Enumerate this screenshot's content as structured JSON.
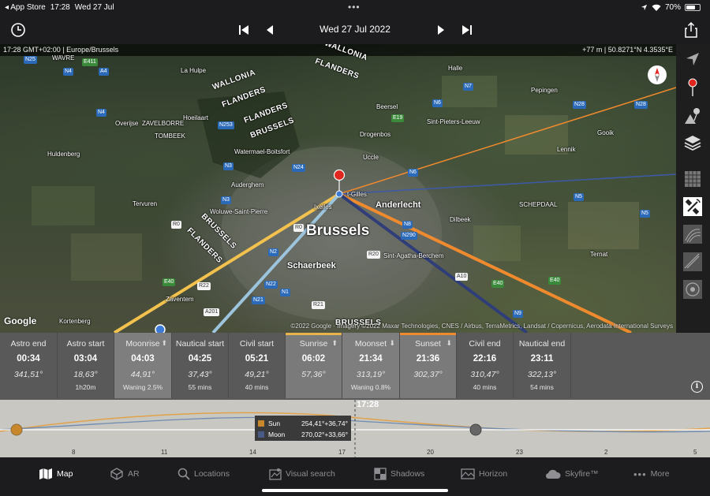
{
  "status": {
    "back_app": "◂ App Store",
    "time": "17:28",
    "date": "Wed 27 Jul",
    "battery": "70%",
    "battery_level": 0.7
  },
  "toolbar": {
    "date": "Wed 27 Jul 2022"
  },
  "map": {
    "time_zone_info": "17:28 GMT+02:00 | Europe/Brussels",
    "elevation_coords": "+77 m | 50.8271°N 4.3535°E",
    "google_label": "Google",
    "copyright": "©2022 Google · Imagery ©2022 Maxar Technologies, CNES / Airbus, TerraMetrics, Landsat / Copernicus, Aerodata International Surveys",
    "labels": {
      "brussels": "Brussels",
      "schaerbeek": "Schaerbeek",
      "anderlecht": "Anderlecht",
      "wallonia1": "WALLONIA",
      "wallonia2": "WALLONIA",
      "flanders1": "FLANDERS",
      "flanders2": "FLANDERS",
      "flanders3": "FLANDERS",
      "flanders4": "FLANDERS",
      "brussels_r1": "BRUSSELS",
      "brussels_r2": "BRUSSELS",
      "brussels_r3": "BRUSSELS",
      "overijse": "Overijse",
      "zavelborre": "ZAVELBORRE",
      "hoeilaart": "Hoeilaart",
      "tombeek": "TOMBEEK",
      "huldenberg": "Huldenberg",
      "watermael": "Watermael-Boitsfort",
      "uccle": "Uccle",
      "drogenbos": "Drogenbos",
      "beersel": "Beersel",
      "sint_pieters": "Sint-Pieters-Leeuw",
      "halle": "Halle",
      "pepingen": "Pepingen",
      "lennik": "Lennik",
      "gooik": "Gooik",
      "auderghem": "Auderghem",
      "tervuren": "Tervuren",
      "woluwe": "Woluwe-Saint-Pierre",
      "ixelles": "Ixelles",
      "saint_gilles": "t-Gilles",
      "dilbeek": "Dilbeek",
      "schepdaal": "SCHEPDAAL",
      "ternat": "Ternat",
      "sint_agatha": "Sint-Agatha-Berchem",
      "zaventem": "Zaventem",
      "kortenberg": "Kortenberg",
      "wavre": "WAVRE",
      "la_hulpe": "La Hulpe"
    },
    "road_badges": [
      "N25",
      "E411",
      "A4",
      "N4",
      "N4",
      "N253",
      "N3",
      "E40",
      "N2",
      "R22",
      "N22",
      "N21",
      "R21",
      "N1",
      "A201",
      "R20",
      "N24",
      "N3",
      "R0",
      "R0",
      "N5",
      "N6",
      "N8",
      "N290",
      "A10",
      "E40",
      "N9",
      "E19",
      "N6",
      "N28",
      "N28",
      "N7",
      "N5",
      "E40"
    ]
  },
  "sidebar": {
    "icons": [
      "location-arrow-icon",
      "map-pin-icon",
      "elevation-pin-icon",
      "layers-icon",
      "grid-icon",
      "satellite-icon",
      "contour-icon",
      "ruler-icon",
      "compass-icon"
    ]
  },
  "events": [
    {
      "name": "Astro end",
      "time": "00:34",
      "azimuth": "341,51°",
      "extra": "",
      "highlight": "",
      "arrow": ""
    },
    {
      "name": "Astro start",
      "time": "03:04",
      "azimuth": "18,63°",
      "extra": "1h20m",
      "highlight": "",
      "arrow": ""
    },
    {
      "name": "Moonrise",
      "time": "04:03",
      "azimuth": "44,91°",
      "extra": "Waning 2.5%",
      "highlight": "moon",
      "arrow": "⬆"
    },
    {
      "name": "Nautical start",
      "time": "04:25",
      "azimuth": "37,43°",
      "extra": "55 mins",
      "highlight": "",
      "arrow": ""
    },
    {
      "name": "Civil start",
      "time": "05:21",
      "azimuth": "49,21°",
      "extra": "40 mins",
      "highlight": "",
      "arrow": ""
    },
    {
      "name": "Sunrise",
      "time": "06:02",
      "azimuth": "57,36°",
      "extra": "",
      "highlight": "sun",
      "arrow": "⬆"
    },
    {
      "name": "Moonset",
      "time": "21:34",
      "azimuth": "313,19°",
      "extra": "Waning 0.8%",
      "highlight": "moon",
      "arrow": "⬇"
    },
    {
      "name": "Sunset",
      "time": "21:36",
      "azimuth": "302,37°",
      "extra": "",
      "highlight": "sun",
      "arrow": "⬇"
    },
    {
      "name": "Civil end",
      "time": "22:16",
      "azimuth": "310,47°",
      "extra": "40 mins",
      "highlight": "",
      "arrow": ""
    },
    {
      "name": "Nautical end",
      "time": "23:11",
      "azimuth": "322,13°",
      "extra": "54 mins",
      "highlight": "",
      "arrow": ""
    }
  ],
  "timeline": {
    "current_time": "17:28",
    "legend": [
      {
        "name": "Sun",
        "value": "254,41°+36,74°",
        "color": "#c8872a"
      },
      {
        "name": "Moon",
        "value": "270,02°+33,66°",
        "color": "#4a5a86"
      }
    ],
    "ticks": [
      "8",
      "11",
      "14",
      "17",
      "20",
      "23",
      "2",
      "5"
    ]
  },
  "tabs": [
    {
      "label": "Map",
      "icon": "map-icon",
      "active": true
    },
    {
      "label": "AR",
      "icon": "ar-icon",
      "active": false
    },
    {
      "label": "Locations",
      "icon": "search-icon",
      "active": false
    },
    {
      "label": "Visual search",
      "icon": "visual-search-icon",
      "active": false
    },
    {
      "label": "Shadows",
      "icon": "shadows-icon",
      "active": false
    },
    {
      "label": "Horizon",
      "icon": "horizon-icon",
      "active": false
    },
    {
      "label": "Skyfire™",
      "icon": "cloud-icon",
      "active": false
    },
    {
      "label": "More",
      "icon": "more-icon",
      "active": false
    }
  ],
  "colors": {
    "sun_line": "#f08a2e",
    "sunrise_line": "#f2c14e",
    "moon_line": "#2f3e78",
    "moonrise_line": "#9cc4dc",
    "sun_highlight": "#e8b34a",
    "sunset_highlight": "#f08a2e"
  }
}
